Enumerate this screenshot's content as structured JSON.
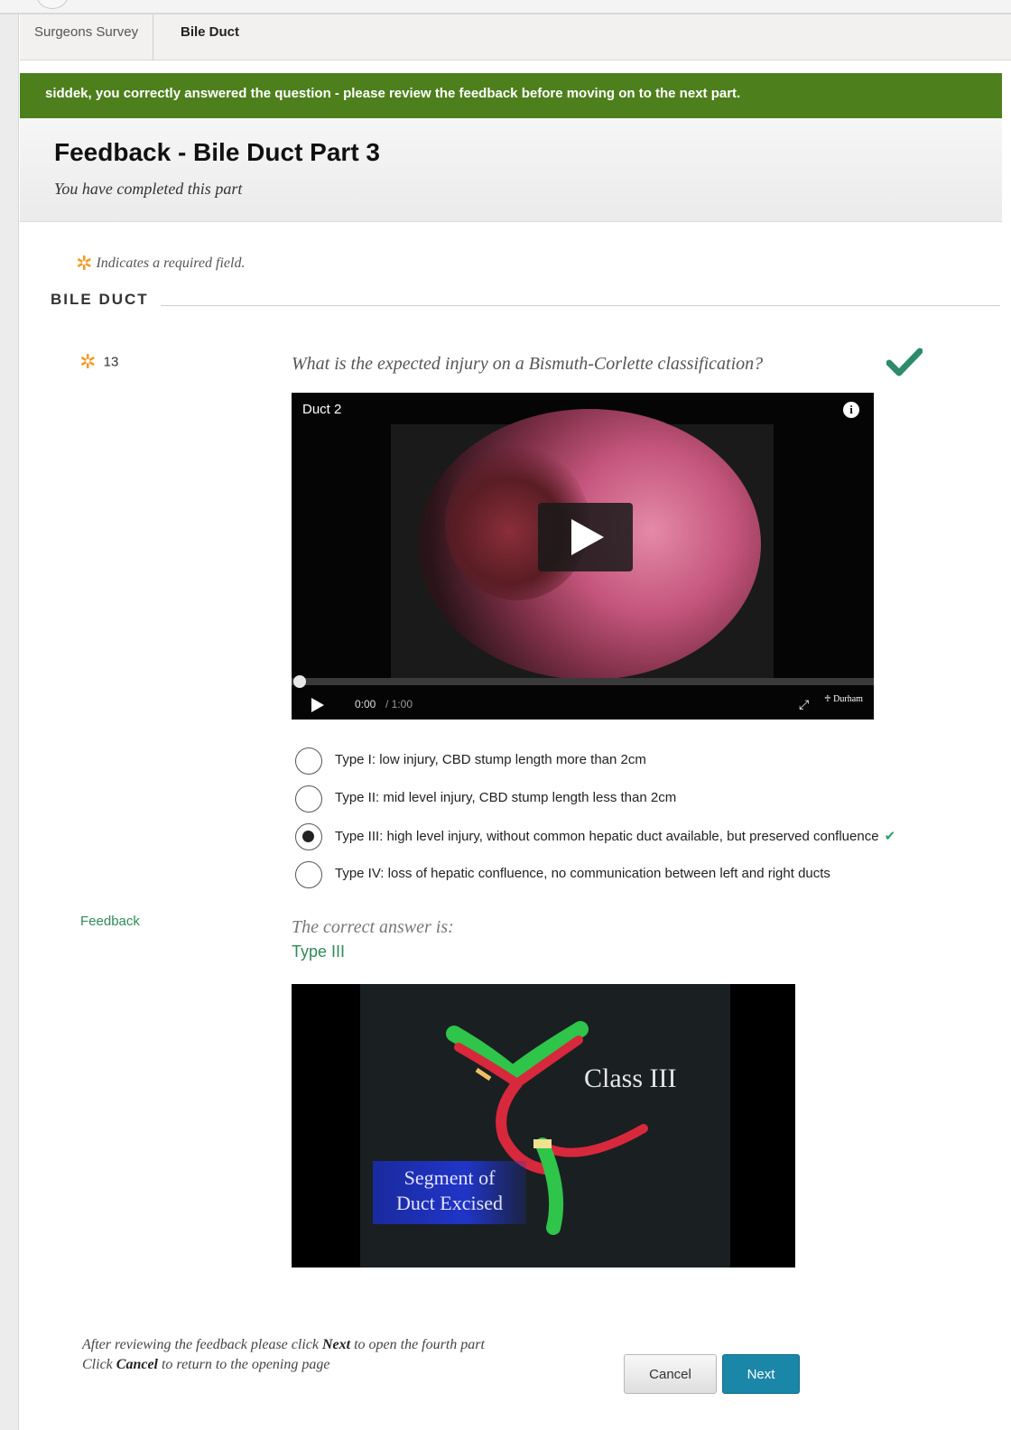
{
  "breadcrumb": {
    "items": [
      "Surgeons Survey",
      "Bile Duct"
    ]
  },
  "banner": {
    "text": "siddek, you correctly answered the question - please review the feedback before moving on to the next part."
  },
  "header": {
    "title": "Feedback - Bile Duct Part 3",
    "subtitle": "You have completed this part"
  },
  "required_note": {
    "symbol": "✲",
    "text": "Indicates a required field."
  },
  "section": {
    "title": "BILE DUCT"
  },
  "question": {
    "number": "13",
    "text": "What is the expected injury on a Bismuth-Corlette classification?",
    "status_icon": "checkmark-icon"
  },
  "video": {
    "title": "Duct 2",
    "current_time": "0:00",
    "duration": "/ 1:00",
    "progress": 0,
    "logo_text": "Durham"
  },
  "options": [
    {
      "label": "Type I: low injury, CBD stump length more than 2cm",
      "selected": false,
      "correct_mark": ""
    },
    {
      "label": "Type II: mid level injury, CBD stump length less than 2cm",
      "selected": false,
      "correct_mark": ""
    },
    {
      "label": "Type III: high level injury, without common hepatic duct available, but preserved confluence",
      "selected": true,
      "correct_mark": "✔"
    },
    {
      "label": "Type IV: loss of hepatic confluence, no communication between left and right ducts",
      "selected": false,
      "correct_mark": ""
    }
  ],
  "feedback": {
    "label": "Feedback",
    "intro": "The correct answer is:",
    "answer": "Type III",
    "image": {
      "class_label": "Class III",
      "segment_line1": "Segment of",
      "segment_line2": "Duct Excised"
    }
  },
  "footer": {
    "line1_pre": "After reviewing the feedback please click ",
    "line1_bold": "Next",
    "line1_post": " to open the fourth part",
    "line2_pre": "Click ",
    "line2_bold": "Cancel",
    "line2_post": " to return to the opening page",
    "cancel_label": "Cancel",
    "next_label": "Next"
  },
  "colors": {
    "banner": "#4d7f1c",
    "accent_green": "#2e8b57",
    "next_button": "#1b87a8",
    "asterisk": "#f39a25"
  }
}
